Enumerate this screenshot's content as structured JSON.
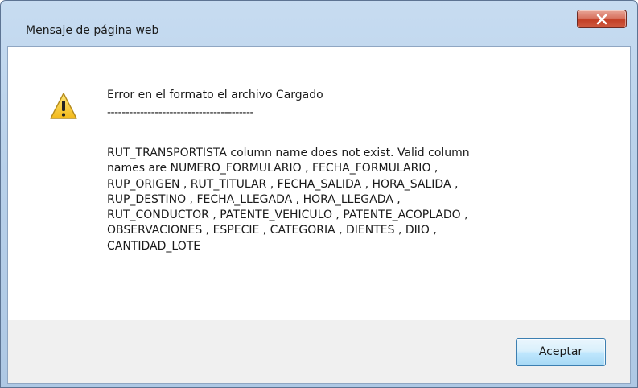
{
  "window": {
    "title": "Mensaje de página web"
  },
  "dialog": {
    "icon": "warning-icon",
    "heading": "Error en el formato el archivo Cargado",
    "divider": "----------------------------------------",
    "message": " RUT_TRANSPORTISTA  column name does not exist. Valid column\nnames are  NUMERO_FORMULARIO ,  FECHA_FORMULARIO ,\nRUP_ORIGEN ,  RUT_TITULAR ,  FECHA_SALIDA ,  HORA_SALIDA ,\nRUP_DESTINO ,  FECHA_LLEGADA ,  HORA_LLEGADA ,\nRUT_CONDUCTOR ,  PATENTE_VEHICULO ,  PATENTE_ACOPLADO ,\nOBSERVACIONES ,  ESPECIE ,  CATEGORIA ,  DIENTES ,  DIIO ,\nCANTIDAD_LOTE"
  },
  "buttons": {
    "ok_label": "Aceptar",
    "close_icon": "close-icon"
  },
  "colors": {
    "frame": "#b9d1ea",
    "close_button": "#c23f26",
    "ok_button": "#bee6fd",
    "footer": "#f0f0f0"
  }
}
